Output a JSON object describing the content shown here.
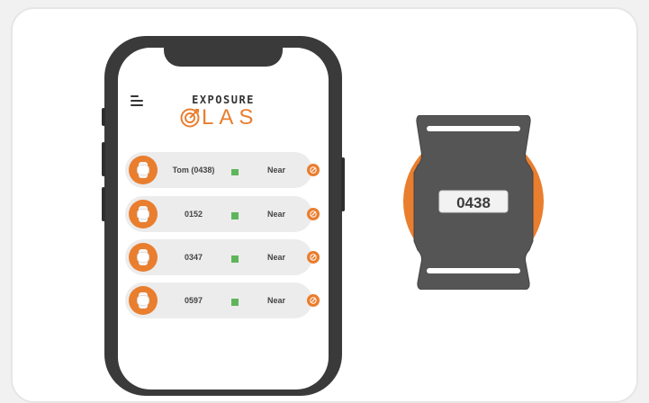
{
  "app": {
    "logo_top": "EXPOSURE",
    "logo_bottom": "LAS",
    "brand_color": "#e97e2f",
    "status_color": "#5fb65a"
  },
  "devices": [
    {
      "name": "Tom (0438)",
      "status": "Near",
      "signal": 0.7
    },
    {
      "name": "0152",
      "status": "Near",
      "signal": 0.75
    },
    {
      "name": "0347",
      "status": "Near",
      "signal": 0.75
    },
    {
      "name": "0597",
      "status": "Near",
      "signal": 0.75
    }
  ],
  "tag": {
    "id": "0438"
  },
  "icons": {
    "menu": "hamburger-menu-icon",
    "avatar": "wearable-tag-icon",
    "edit": "edit-pencil-icon",
    "logo": "target-logo-icon"
  }
}
